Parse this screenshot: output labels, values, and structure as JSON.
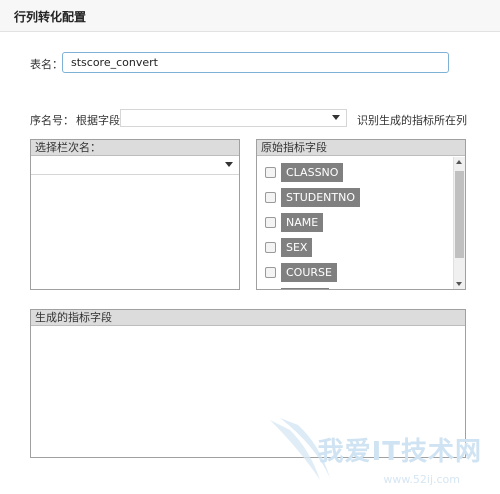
{
  "header": {
    "title": "行列转化配置"
  },
  "form": {
    "table_name_label": "表名：",
    "table_name_value": "stscore_convert",
    "seq_label": "序名号：",
    "by_field_label": "根据字段",
    "seq_select_value": "",
    "identify_label": "识别生成的指标所在列"
  },
  "select_column_panel": {
    "title": "选择栏次名：",
    "select_value": ""
  },
  "original_fields_panel": {
    "title": "原始指标字段",
    "items": [
      {
        "label": "CLASSNO"
      },
      {
        "label": "STUDENTNO"
      },
      {
        "label": "NAME"
      },
      {
        "label": "SEX"
      },
      {
        "label": "COURSE"
      },
      {
        "label": ""
      }
    ]
  },
  "generated_fields_panel": {
    "title": "生成的指标字段"
  },
  "watermark": {
    "text": "我爱IT技术网",
    "url": "www.52ij.com"
  }
}
